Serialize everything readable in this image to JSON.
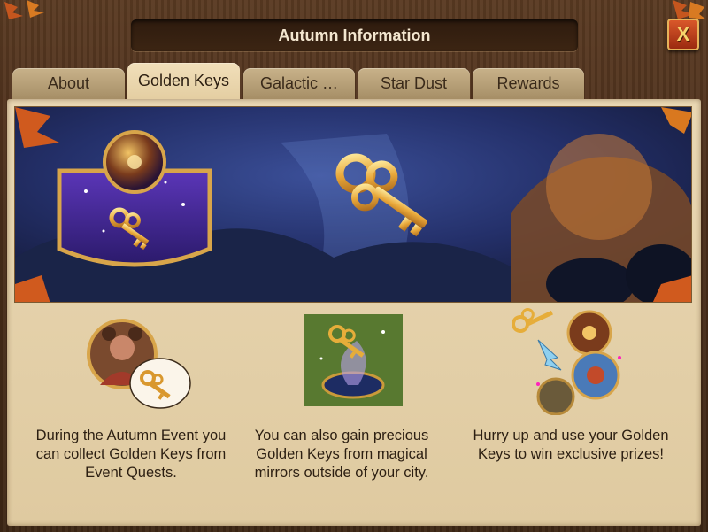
{
  "window": {
    "title": "Autumn Information",
    "close_label": "X"
  },
  "tabs": [
    {
      "label": "About",
      "active": false
    },
    {
      "label": "Golden Keys",
      "active": true
    },
    {
      "label": "Galactic …",
      "active": false
    },
    {
      "label": "Star Dust",
      "active": false
    },
    {
      "label": "Rewards",
      "active": false
    }
  ],
  "banner": {
    "icons": [
      "mirror-badge-icon",
      "golden-key-icon"
    ]
  },
  "cards": [
    {
      "text": "During the Autumn Event you can collect Golden Keys from Event Quests.",
      "icon": "character-with-key-icon"
    },
    {
      "text": "You can also gain precious Golden Keys from magical mirrors outside of your city.",
      "icon": "magic-mirror-icon"
    },
    {
      "text": "Hurry up and use your Golden Keys to win exclusive prizes!",
      "icon": "key-to-prizes-icon"
    }
  ],
  "colors": {
    "accent": "#d9582a",
    "gold": "#e9b24a",
    "parchment": "#e9d7b3"
  }
}
